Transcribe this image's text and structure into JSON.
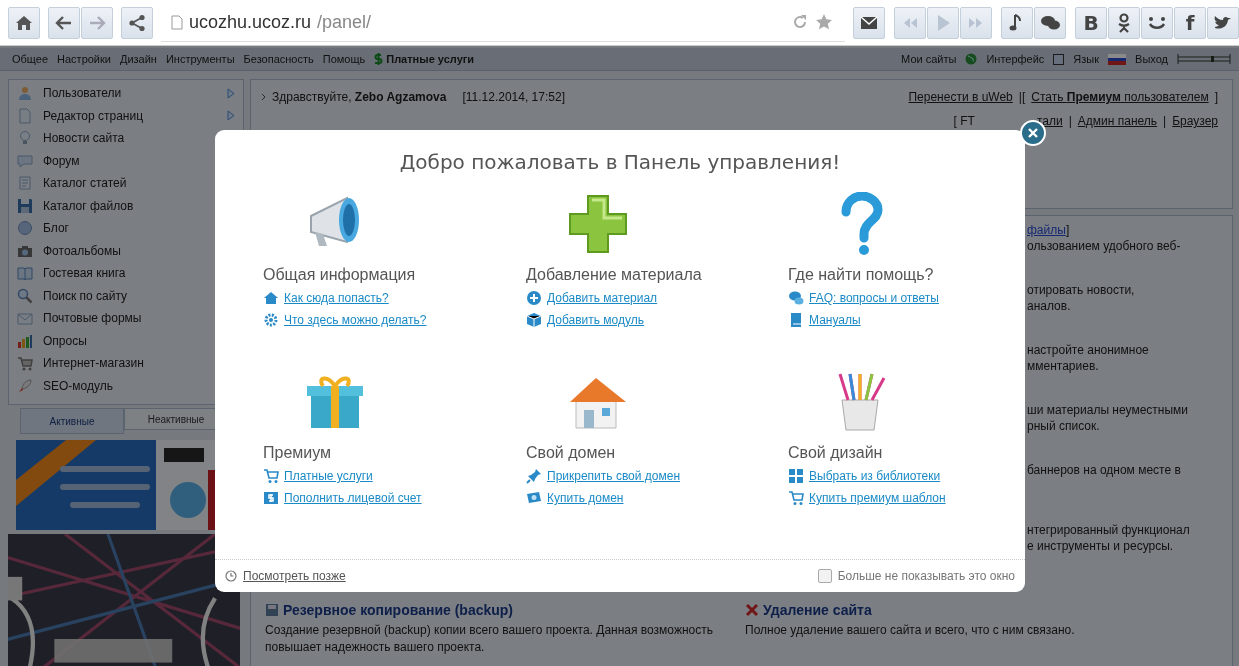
{
  "browser": {
    "url_host": "ucozhu.ucoz.ru",
    "url_path": "/panel/",
    "toolbar": [
      {
        "kind": "mail"
      },
      {
        "kind": "rewind"
      },
      {
        "kind": "play"
      },
      {
        "kind": "forward"
      },
      {
        "kind": "note"
      },
      {
        "kind": "chat"
      },
      {
        "kind": "letter",
        "glyph": "В"
      },
      {
        "kind": "ok"
      },
      {
        "kind": "smile"
      },
      {
        "kind": "letter",
        "glyph": "f"
      },
      {
        "kind": "bird"
      }
    ]
  },
  "menu": {
    "items": [
      "Общее",
      "Настройки",
      "Дизайн",
      "Инструменты",
      "Безопасность",
      "Помощь"
    ],
    "paid": "Платные услуги",
    "right": [
      {
        "label": "Мои сайты",
        "kind": "globe"
      },
      {
        "label": "Интерфейс",
        "kind": "square"
      },
      {
        "label": "Язык",
        "kind": "flag"
      },
      {
        "label": "Выход",
        "kind": "none"
      }
    ]
  },
  "sidebar": {
    "items": [
      {
        "label": "Пользователи",
        "has_submenu": true
      },
      {
        "label": "Редактор страниц",
        "has_submenu": true
      },
      {
        "label": "Новости сайта"
      },
      {
        "label": "Форум"
      },
      {
        "label": "Каталог статей"
      },
      {
        "label": "Каталог файлов"
      },
      {
        "label": "Блог"
      },
      {
        "label": "Фотоальбомы"
      },
      {
        "label": "Гостевая книга"
      },
      {
        "label": "Поиск по сайту"
      },
      {
        "label": "Почтовые формы"
      },
      {
        "label": "Опросы"
      },
      {
        "label": "Интернет-магазин"
      },
      {
        "label": "SEO-модуль"
      }
    ],
    "tabs": [
      {
        "label": "Активные",
        "selected": true
      },
      {
        "label": "Неактивные",
        "selected": false
      }
    ]
  },
  "header": {
    "greeting": "Здравствуйте, **Zebo Agzamova**",
    "datetime": "[11.12.2014, 17:52]",
    "right": [
      {
        "kind": "link",
        "text": "Перенести в uWeb"
      },
      {
        "kind": "sep",
        "text": "|["
      },
      {
        "kind": "link",
        "text": "Стать **Премиум** пользователем"
      },
      {
        "kind": "sep",
        "text": "]"
      }
    ],
    "links_row": [
      {
        "kind": "sep",
        "text": "[ FT"
      },
      {
        "kind": "gap"
      },
      {
        "kind": "link",
        "text": "тали"
      },
      {
        "kind": "sep",
        "text": "|"
      },
      {
        "kind": "link",
        "text": "Админ панель"
      },
      {
        "kind": "sep",
        "text": "|"
      },
      {
        "kind": "link",
        "text": "Браузер"
      }
    ]
  },
  "content": {
    "fragments": [
      {
        "link": "файлы",
        "after": "]",
        "lines": [
          "ользованием удобного веб-"
        ]
      },
      {
        "lines": [
          "отировать новости,",
          "аналов."
        ]
      },
      {
        "lines": [
          "настройте анонимное",
          "мментариев."
        ]
      },
      {
        "lines": [
          "ши материалы неуместными",
          "рный список."
        ]
      },
      {
        "lines": [
          "баннеров на одном месте в"
        ]
      },
      {
        "lines": [
          "нтегрированный функционал",
          "е инструменты и ресурсы."
        ]
      }
    ],
    "features": [
      {
        "kind": "backup",
        "title": "Резервное копирование (backup)",
        "text": "Создание резервной (backup) копии всего вашего проекта. Данная возможность повышает надежность вашего проекта."
      },
      {
        "kind": "delete",
        "title": "Удаление сайта",
        "text": "Полное удаление вашего сайта и всего, что с ним связано."
      }
    ]
  },
  "dialog": {
    "title": "Добро пожаловать в Панель управления!",
    "sections": [
      {
        "title": "Общая информация",
        "links": [
          "Как сюда попасть?",
          "Что здесь можно делать?"
        ]
      },
      {
        "title": "Добавление материала",
        "links": [
          "Добавить материал",
          "Добавить модуль"
        ]
      },
      {
        "title": "Где найти помощь?",
        "links": [
          "FAQ: вопросы и ответы",
          "Мануалы"
        ]
      },
      {
        "title": "Премиум",
        "links": [
          "Платные услуги",
          "Пополнить лицевой счет"
        ]
      },
      {
        "title": "Свой домен",
        "links": [
          "Прикрепить свой домен",
          "Купить домен"
        ]
      },
      {
        "title": "Свой дизайн",
        "links": [
          "Выбрать из библиотеки",
          "Купить премиум шаблон"
        ]
      }
    ],
    "later_link": "Посмотреть позже",
    "dont_show": {
      "label": "Больше не показывать это окно",
      "checked": false
    }
  }
}
